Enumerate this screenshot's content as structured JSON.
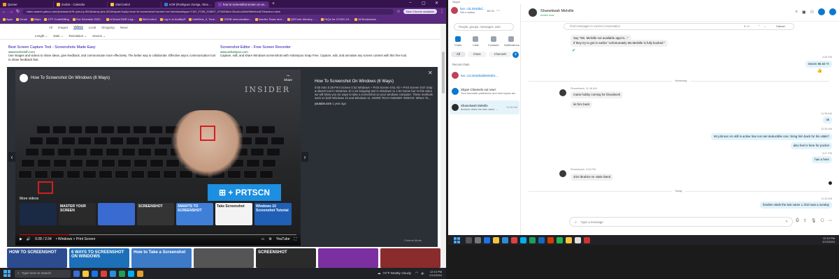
{
  "colors": {
    "chrome_purple": "#35134d",
    "skype_blue": "#0b79d0",
    "accent_red": "#d21f1f"
  },
  "browser": {
    "tabs": [
      {
        "label": "Qvener",
        "color": "#f29a2e"
      },
      {
        "label": "Zoobix - Calendar",
        "color": "#f5c542"
      },
      {
        "label": "SiteControl",
        "color": "#f5c542"
      },
      {
        "label": "eOR (Rodriguez Zuniga, Alma ...",
        "color": "#2a7fd4"
      },
      {
        "label": "how to screenshot screen on wi...",
        "color": "#7b3fbf"
      }
    ],
    "url": "video.search.yahoo.com/yhs/search?fr=yhs-iry-001&hsimp=yhs-001&hspart=iry&p=how+to+screenshot+screen+on+windows&type=Y167_F155_223627_070523#id=2&vid=a2b0e5f6e9c4d27f&action=view",
    "new_chrome": "New Chrome available",
    "bookmarks": [
      "Apps",
      "Gmail",
      "Maps",
      "OTF Code/Billing",
      "Fax Schedule 2022...",
      "eClinical EMR Logi...",
      "SiteControl",
      "Log in to Availity®",
      "IntelliVue_4, Tone...",
      "OSHB Immunization...",
      "Imertex Tower and...",
      "QRCode Monkey - ...",
      "FAQs for COVID-19...",
      "All Bookmarks"
    ],
    "vertical_tabs": [
      "All",
      "Images",
      "Videos",
      "Local",
      "Shopping",
      "News"
    ],
    "active_vertical": "Videos",
    "filters": [
      "Length",
      "Date",
      "Resolution",
      "Source"
    ],
    "ads": [
      {
        "title": "Best Screen Capture Tool - Screenshots Made Easy",
        "url": "www.techsmith.com",
        "desc": "Use images and videos to share ideas, give feedback, and communicate more effectively. The better way to collaborate. Effective async communication tool to share feedback fast."
      },
      {
        "title": "Screenshot Editor - Free Screen Recorder",
        "url": "www.ashampoo.com",
        "desc": "Capture, edit, and share Windows screenshots with Ashampoo Snap Free. Capture, edit, and annotate any screen content with this free tool."
      }
    ],
    "video": {
      "title": "How To Screenshot On Windows (6 Ways)",
      "share": "Share",
      "watermark": "INSIDER",
      "key_label": "⊞ + PRTSCN",
      "more_videos": "More videos",
      "thumbs": [
        {
          "text": "",
          "color": "#1b2a44"
        },
        {
          "text": "MASTER YOUR SCREEN",
          "color": "#2a2a2a"
        },
        {
          "text": "",
          "color": "#3a6bd1"
        },
        {
          "text": "SCREENSHOT",
          "color": "#343434"
        },
        {
          "text": "SMARTS TO SCREENSHOT",
          "color": "#3f7fd8"
        },
        {
          "text": "Take Screenshot",
          "color": "#f3f3f3"
        },
        {
          "text": "Windows 10 Screenshot Tutorial",
          "color": "#1f5fb5"
        }
      ],
      "time": "0:28 / 2:34",
      "chapter": "• Windows + Print Screen",
      "progress": 0.18,
      "youtube": "YouTube",
      "cinema": "Cinema Mode"
    },
    "info": {
      "title": "How To Screenshot On Windows (6 Ways)",
      "desc": "0:00 Intro 0:28 Print Screen 0:32 Windows + Print Screen 0:51 Alt + Print Screen 0:57 Snip & sketch tool In Windows 10 1:26 Snipping tool in Windows 11 1:52 Game bar In this video we will show you six ways to take a screenshot on your windows computer. These methods work on both Windows 10 and Windows 11. MORE TECH INSIDER VIDEOS: Where To...",
      "source": "youtube.com",
      "age": "1 year ago"
    },
    "related": [
      {
        "text": "HOW TO SCREENSHOT",
        "color": "#2d4c8f"
      },
      {
        "text": "6 WAYS TO SCREENSHOT ON WINDOWS",
        "color": "#1d6fb8"
      },
      {
        "text": "How to Take a Screenshot",
        "color": "#3d7ac7"
      },
      {
        "text": "",
        "color": "#555"
      },
      {
        "text": "SCREENSHOT",
        "color": "#2b2b2b"
      },
      {
        "text": "",
        "color": "#7b2fa0"
      },
      {
        "text": "",
        "color": "#8a2c2c"
      }
    ]
  },
  "taskbar_left": {
    "search": "Type here to search",
    "weather": "74°F  Mostly cloudy",
    "time": "12:10 PM",
    "date": "2/12/2024"
  },
  "skype": {
    "app_title": "Skype",
    "profile": {
      "name": "live:.cid.284d5d...",
      "balance": "$0.00",
      "status": "Set a status"
    },
    "search": "People, groups, messages, web",
    "nav": [
      "Chats",
      "Calls",
      "Contacts",
      "Notifications"
    ],
    "filters": [
      "All",
      "Chats",
      "Channels"
    ],
    "recent_label": "Recent chats",
    "chats": [
      {
        "name": "live:.cid.284d5dd9606d0c...",
        "sub": "",
        "time": ""
      },
      {
        "name": "Skype Channels out now!",
        "sub": "Your favourite publishers and new topics are waiting for you! Join Sky...",
        "time": ""
      },
      {
        "name": "Shanekwah Melville",
        "sub": "ibrahim vitals the last name ...",
        "time": "11:35 AM"
      }
    ],
    "header": {
      "name": "Shanekwah Melville",
      "status": "Active now"
    },
    "find_placeholder": "Find messages in current conversation",
    "find_count": "0 / 0",
    "find_cancel": "Cancel",
    "messages": [
      {
        "dir": "in",
        "text": "Say \"Ms. Melville not available appt is...\"",
        "meta": ""
      },
      {
        "dir": "in",
        "text": "If they try to get in earlier \"unfortunately Ms.Melville is fully booked \"",
        "meta": ""
      },
      {
        "dir": "out",
        "text": "Seven 85.63 Yr",
        "meta": "3:26 PM"
      },
      {
        "dir": "in",
        "text": "maria hubby coming for bloodwork",
        "meta": "Shanekwah, 11:18 AM"
      },
      {
        "dir": "in",
        "text": "let him back",
        "meta": ""
      },
      {
        "dir": "out",
        "text": "ok",
        "meta": "11:35 AM"
      },
      {
        "dir": "out",
        "text": "Mr johnson iro still is active has not met deductible can i bring him back for his vitals?",
        "meta": "12:35 AM"
      },
      {
        "dir": "out",
        "text": "also feel is here for pocket",
        "meta": ""
      },
      {
        "dir": "out",
        "text": "hav a here",
        "meta": "3:27 PM"
      },
      {
        "dir": "in",
        "text": "3/10 ibrahim mr vitals listed",
        "meta": "Shanekwah, 3:24 PM"
      },
      {
        "dir": "out",
        "text": "ibrahim vitals the last name 1  3/10 was a sunday",
        "meta": "11:32 AM"
      }
    ],
    "dividers": [
      "Yesterday",
      "Today"
    ],
    "composer": "Type a message"
  },
  "taskbar_right": {
    "time": "12:10 PM",
    "date": "2/12/2024"
  }
}
